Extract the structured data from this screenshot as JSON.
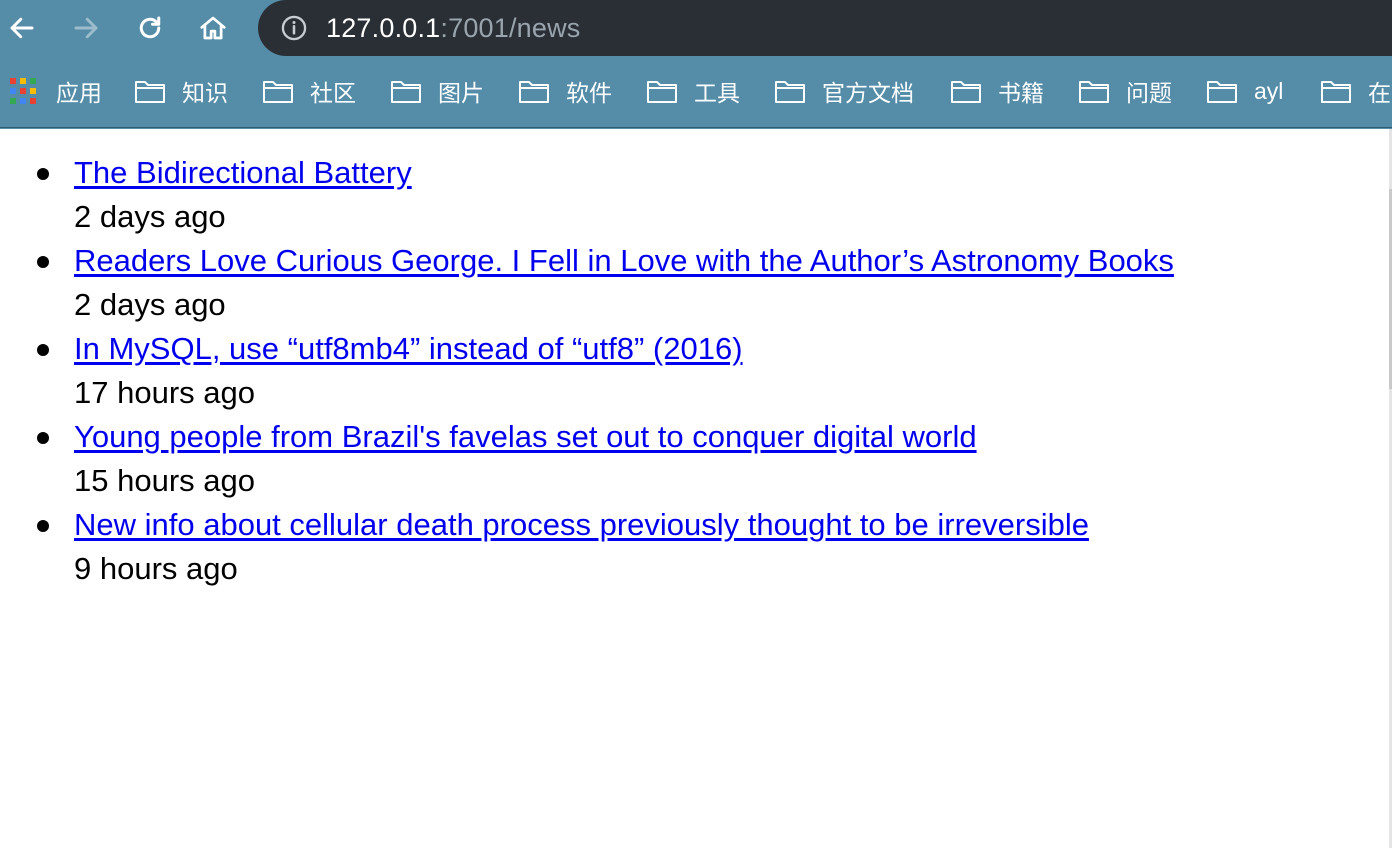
{
  "browser": {
    "url_host": "127.0.0.1",
    "url_rest": ":7001/news",
    "icons": {
      "back": "back-arrow-icon",
      "forward": "forward-arrow-icon",
      "reload": "reload-icon",
      "home": "home-icon",
      "info": "info-icon"
    },
    "bookmarks": [
      {
        "label": "应用",
        "icon": "apps-grid-icon"
      },
      {
        "label": "知识",
        "icon": "folder-icon"
      },
      {
        "label": "社区",
        "icon": "folder-icon"
      },
      {
        "label": "图片",
        "icon": "folder-icon"
      },
      {
        "label": "软件",
        "icon": "folder-icon"
      },
      {
        "label": "工具",
        "icon": "folder-icon"
      },
      {
        "label": "官方文档",
        "icon": "folder-icon"
      },
      {
        "label": "书籍",
        "icon": "folder-icon"
      },
      {
        "label": "问题",
        "icon": "folder-icon"
      },
      {
        "label": "ayl",
        "icon": "folder-icon"
      },
      {
        "label": "在",
        "icon": "folder-icon"
      }
    ],
    "colors": {
      "chrome_bg": "#558ca8",
      "omnibox_bg": "#2a2f35",
      "link": "#0000ee"
    }
  },
  "news": [
    {
      "title": "The Bidirectional Battery",
      "time": "2 days ago"
    },
    {
      "title": "Readers Love Curious George. I Fell in Love with the Author’s Astronomy Books",
      "time": "2 days ago"
    },
    {
      "title": "In MySQL, use “utf8mb4” instead of “utf8” (2016)",
      "time": "17 hours ago"
    },
    {
      "title": "Young people from Brazil's favelas set out to conquer digital world",
      "time": "15 hours ago"
    },
    {
      "title": "New info about cellular death process previously thought to be irreversible",
      "time": "9 hours ago"
    }
  ]
}
